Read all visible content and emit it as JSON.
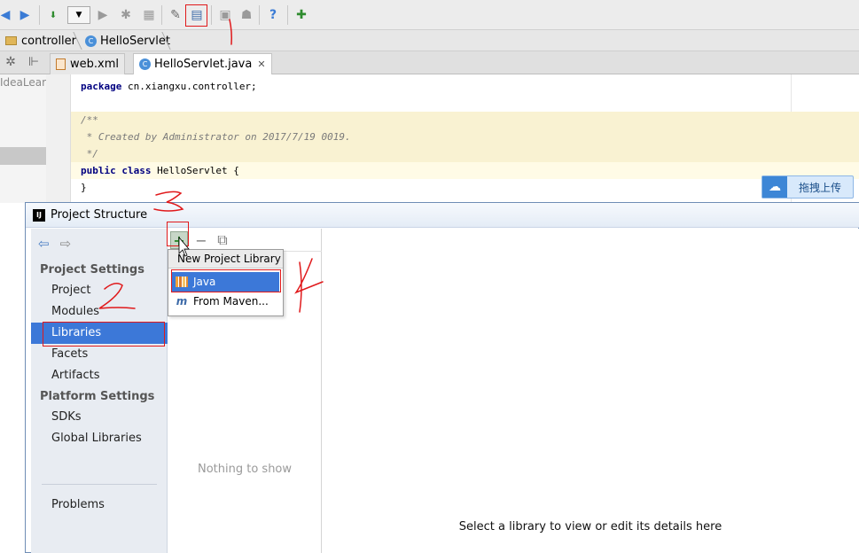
{
  "ide": {
    "breadcrumbs": [
      "controller",
      "HelloServlet"
    ],
    "tabs": [
      "web.xml",
      "HelloServlet.java"
    ],
    "side_strip_text": "IdeaLear",
    "code_lines": [
      "package cn.xiangxu.controller;",
      "",
      "/**",
      " * Created by Administrator on 2017/7/19 0019.",
      " */",
      "public class HelloServlet {",
      "}"
    ],
    "upload_button": "拖拽上传"
  },
  "dialog": {
    "title": "Project Structure",
    "project_settings_header": "Project Settings",
    "project_settings_items": [
      "Project",
      "Modules",
      "Libraries",
      "Facets",
      "Artifacts"
    ],
    "platform_settings_header": "Platform Settings",
    "platform_settings_items": [
      "SDKs",
      "Global Libraries"
    ],
    "problems_label": "Problems",
    "selected_item": "Libraries",
    "empty_list_text": "Nothing to show",
    "detail_message": "Select a library to view or edit its details here"
  },
  "popup": {
    "title": "New Project Library",
    "items": [
      "Java",
      "From Maven..."
    ],
    "highlighted": "Java"
  },
  "colors": {
    "selection": "#3c78d8",
    "annotation_red": "#e0191b"
  }
}
